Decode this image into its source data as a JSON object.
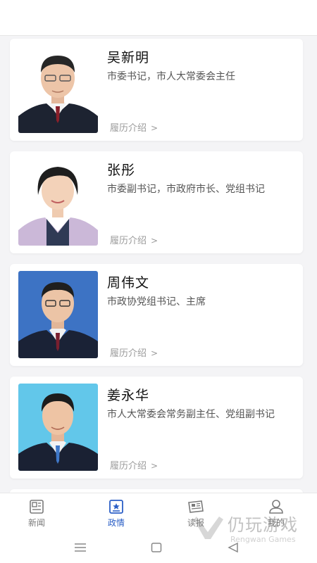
{
  "officials": [
    {
      "name": "吴新明",
      "title": "市委书记，市人大常委会主任",
      "resume_label": "履历介绍",
      "chevron": ">",
      "photo_bg": "#ffffff"
    },
    {
      "name": "张彤",
      "title": "市委副书记，市政府市长、党组书记",
      "resume_label": "履历介绍",
      "chevron": ">",
      "photo_bg": "#ffffff"
    },
    {
      "name": "周伟文",
      "title": "市政协党组书记、主席",
      "resume_label": "履历介绍",
      "chevron": ">",
      "photo_bg": "#3d73c4"
    },
    {
      "name": "姜永华",
      "title": "市人大常委会常务副主任、党组副书记",
      "resume_label": "履历介绍",
      "chevron": ">",
      "photo_bg": "#62c7ea"
    }
  ],
  "tabs": [
    {
      "label": "新闻",
      "icon": "news-icon",
      "active": false
    },
    {
      "label": "政情",
      "icon": "politics-icon",
      "active": true
    },
    {
      "label": "读报",
      "icon": "newspaper-icon",
      "active": false
    },
    {
      "label": "我的",
      "icon": "user-icon",
      "active": false
    }
  ],
  "colors": {
    "accent": "#2b5fc6",
    "inactive": "#7a7a7a"
  },
  "watermark": {
    "text": "仍玩游戏",
    "sub": "Rengwan Games"
  }
}
